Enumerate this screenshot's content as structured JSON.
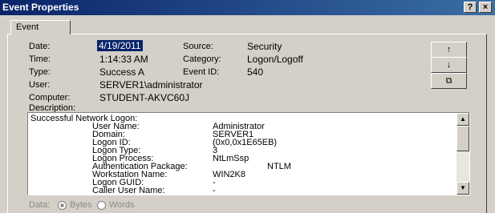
{
  "window": {
    "title": "Event Properties",
    "help_label": "?",
    "close_label": "×"
  },
  "tab": {
    "label": "Event"
  },
  "fields": {
    "date_label": "Date:",
    "date_value": "4/19/2011",
    "source_label": "Source:",
    "source_value": "Security",
    "time_label": "Time:",
    "time_value": "1:14:33 AM",
    "category_label": "Category:",
    "category_value": "Logon/Logoff",
    "type_label": "Type:",
    "type_value": "Success A",
    "eventid_label": "Event ID:",
    "eventid_value": "540",
    "user_label": "User:",
    "user_value": "SERVER1\\administrator",
    "computer_label": "Computer:",
    "computer_value": "STUDENT-AKVC60J"
  },
  "side_buttons": {
    "up": "↑",
    "down": "↓",
    "copy": "⧉"
  },
  "description": {
    "label": "Description:",
    "heading": "Successful Network Logon:",
    "rows": [
      {
        "key": "User Name:",
        "value": "Administrator"
      },
      {
        "key": "Domain:",
        "value": "SERVER1"
      },
      {
        "key": "Logon ID:",
        "value": "(0x0,0x1E65EB)"
      },
      {
        "key": "Logon Type:",
        "value": "3"
      },
      {
        "key": "Logon Process:",
        "value": "NtLmSsp"
      },
      {
        "key": "Authentication Package:",
        "value": "NTLM"
      },
      {
        "key": "Workstation Name:",
        "value": "WIN2K8"
      },
      {
        "key": "Logon GUID:",
        "value": "-"
      },
      {
        "key": "Caller User Name:",
        "value": "-"
      }
    ]
  },
  "data_format": {
    "label": "Data:",
    "bytes_label": "Bytes",
    "words_label": "Words",
    "selected": "Bytes"
  }
}
